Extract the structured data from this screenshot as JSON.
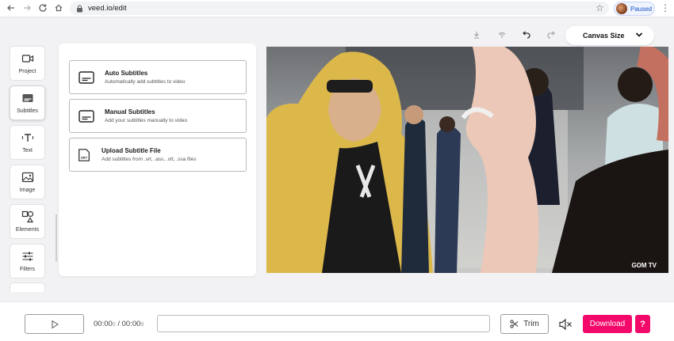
{
  "browser": {
    "url": "veed.io/edit",
    "profile_status": "Paused"
  },
  "toolbar": {
    "canvas_size_label": "Canvas Size"
  },
  "sidebar": {
    "items": [
      {
        "label": "Project",
        "icon": "video-camera-icon"
      },
      {
        "label": "Subtitles",
        "icon": "subtitles-icon",
        "active": true
      },
      {
        "label": "Text",
        "icon": "text-icon"
      },
      {
        "label": "Image",
        "icon": "image-icon"
      },
      {
        "label": "Elements",
        "icon": "shapes-icon"
      },
      {
        "label": "Filters",
        "icon": "sliders-icon"
      }
    ]
  },
  "subtitles_panel": {
    "options": [
      {
        "title": "Auto Subtitles",
        "description": "Automatically add subtitles to video",
        "icon": "subtitle-box-icon"
      },
      {
        "title": "Manual Subtitles",
        "description": "Add your subtitles manually to video",
        "icon": "subtitle-box-icon"
      },
      {
        "title": "Upload Subtitle File",
        "description": "Add subtitles from .srt, .ass, .vtt, .ssa files",
        "icon": "srt-file-icon"
      }
    ]
  },
  "video": {
    "watermark": "GOM TV"
  },
  "player": {
    "current_time": "00:00",
    "current_time_fraction": "0",
    "separator": "/",
    "total_time": "00:00",
    "total_time_fraction": "9",
    "trim_label": "Trim",
    "download_label": "Download",
    "help_label": "?"
  },
  "colors": {
    "accent": "#f2096a",
    "canvas_bg": "#f2f2f4"
  }
}
